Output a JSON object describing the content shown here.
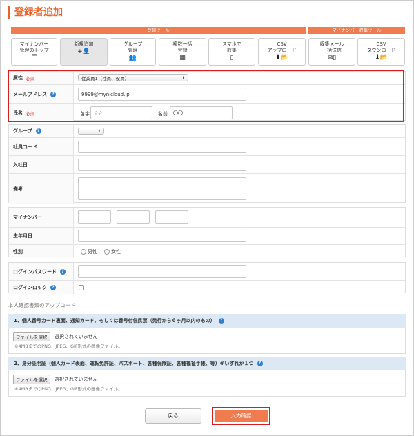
{
  "page_title": "登録者追加",
  "toolbar": {
    "group1_title": "登録ツール",
    "group2_title": "マイナンバー収集ツール",
    "buttons": [
      {
        "line1": "マイナンバー",
        "line2": "管理のトップ",
        "icon": "☰"
      },
      {
        "line1": "新規追加",
        "line2": "",
        "icon": "+👤"
      },
      {
        "line1": "グループ",
        "line2": "管理",
        "icon": "👥"
      },
      {
        "line1": "複数一括",
        "line2": "登録",
        "icon": "▦"
      },
      {
        "line1": "スマホで",
        "line2": "収集",
        "icon": "▯"
      },
      {
        "line1": "CSV",
        "line2": "アップロード",
        "icon": "⬆📂"
      },
      {
        "line1": "収集メール",
        "line2": "一括送信",
        "icon": "✉▯"
      },
      {
        "line1": "CSV",
        "line2": "ダウンロード",
        "icon": "⬇📂"
      }
    ]
  },
  "required_label": "必須",
  "help_icon": "?",
  "form": {
    "attribute": {
      "label": "属性",
      "value": "従業員1（社員、役員）"
    },
    "email": {
      "label": "メールアドレス",
      "value": "9999@mynicloud.jp"
    },
    "name": {
      "label": "氏名",
      "last_label": "苗字",
      "last_value": "☆☆",
      "first_label": "名前",
      "first_value": "〇〇"
    },
    "group": {
      "label": "グループ",
      "value": ""
    },
    "employee_code": {
      "label": "社員コード",
      "value": ""
    },
    "hire_date": {
      "label": "入社日",
      "value": ""
    },
    "remarks": {
      "label": "備考",
      "value": ""
    },
    "my_number": {
      "label": "マイナンバー"
    },
    "birth_date": {
      "label": "生年月日",
      "value": ""
    },
    "gender": {
      "label": "性別",
      "male": "男性",
      "female": "女性"
    },
    "login_password": {
      "label": "ログインパスワード",
      "value": ""
    },
    "login_lock": {
      "label": "ログインロック"
    }
  },
  "upload": {
    "section_title": "本人確認書類のアップロード",
    "items": [
      {
        "title": "1、個人番号カード裏面、通知カード、もしくは番号付住民票（発行から６ヶ月以内のもの）",
        "button": "ファイルを選択",
        "status": "選択されていません",
        "note": "※4MBまでのPNG、JPEG、GIF形式の画像ファイル。"
      },
      {
        "title": "2、身分証明証（個人カード表面、運転免許証、パスポート、各種保険証、各種福祉手帳、等）※いずれか１つ",
        "button": "ファイルを選択",
        "status": "選択されていません",
        "note": "※4MBまでのPNG、JPEG、GIF形式の画像ファイル。"
      }
    ]
  },
  "actions": {
    "back": "戻る",
    "confirm": "入力確認"
  },
  "colors": {
    "accent": "#ef7b4e",
    "highlight": "#d61f1f",
    "help": "#2f7fce",
    "upload_header": "#dce8f3"
  }
}
